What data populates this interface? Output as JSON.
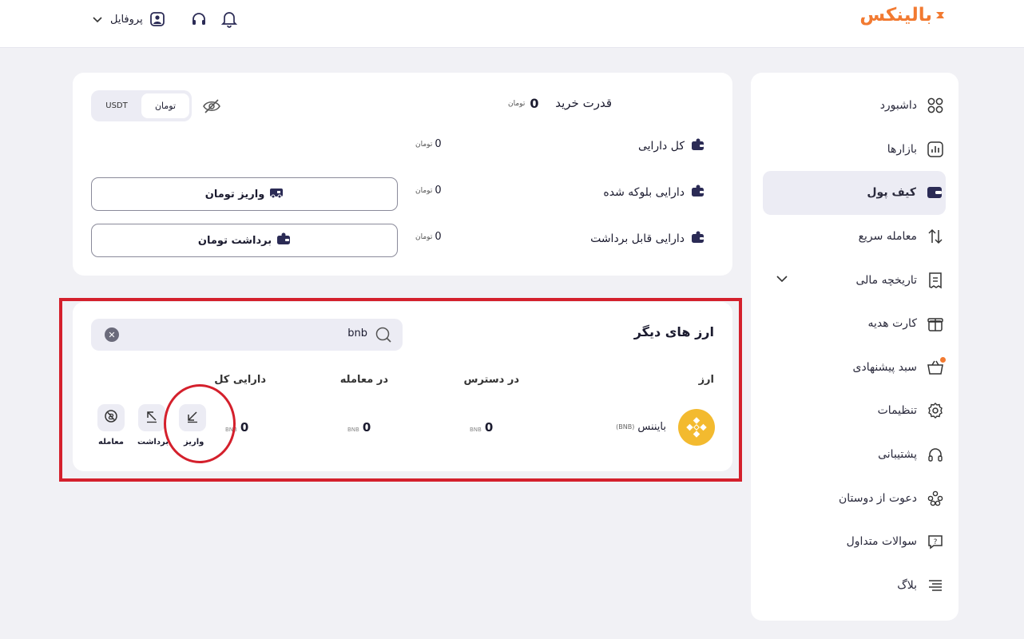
{
  "brand": {
    "logo_text": "بالینکس",
    "color": "#f27a31"
  },
  "topbar": {
    "profile_label": "پروفایل"
  },
  "sidebar": {
    "items": [
      {
        "label": "داشبورد",
        "icon": "grid-icon"
      },
      {
        "label": "بازارها",
        "icon": "chart-icon"
      },
      {
        "label": "کیف پول",
        "icon": "wallet-icon",
        "active": true
      },
      {
        "label": "معامله سریع",
        "icon": "swap-icon"
      },
      {
        "label": "تاریخچه مالی",
        "icon": "receipt-icon"
      },
      {
        "label": "کارت هدیه",
        "icon": "gift-icon"
      },
      {
        "label": "سبد پیشنهادی",
        "icon": "basket-icon"
      },
      {
        "label": "تنظیمات",
        "icon": "gear-icon"
      },
      {
        "label": "پشتیبانی",
        "icon": "headset-icon"
      },
      {
        "label": "دعوت از دوستان",
        "icon": "users-icon"
      },
      {
        "label": "سوالات متداول",
        "icon": "question-icon"
      },
      {
        "label": "بلاگ",
        "icon": "list-icon"
      }
    ]
  },
  "balance": {
    "purchase_power_label": "قدرت خرید",
    "purchase_power_value": "0",
    "currency_unit": "تومان",
    "toggle_active": "تومان",
    "toggle_other": "USDT",
    "rows": [
      {
        "label": "کل دارایی",
        "value": "0"
      },
      {
        "label": "دارایی بلوکه شده",
        "value": "0"
      },
      {
        "label": "دارایی قابل برداشت",
        "value": "0"
      }
    ],
    "deposit_button": "واریز تومان",
    "withdraw_button": "برداشت تومان"
  },
  "other_currencies": {
    "title": "ارز های دیگر",
    "search_value": "bnb",
    "columns": [
      "ارز",
      "در دسترس",
      "در معامله",
      "دارایی کل"
    ],
    "row": {
      "coin_name": "بایننس",
      "coin_symbol": "(BNB)",
      "available": "0",
      "in_trade": "0",
      "total": "0",
      "unit": "BNB"
    },
    "actions": [
      "واریز",
      "برداشت",
      "معامله"
    ]
  }
}
